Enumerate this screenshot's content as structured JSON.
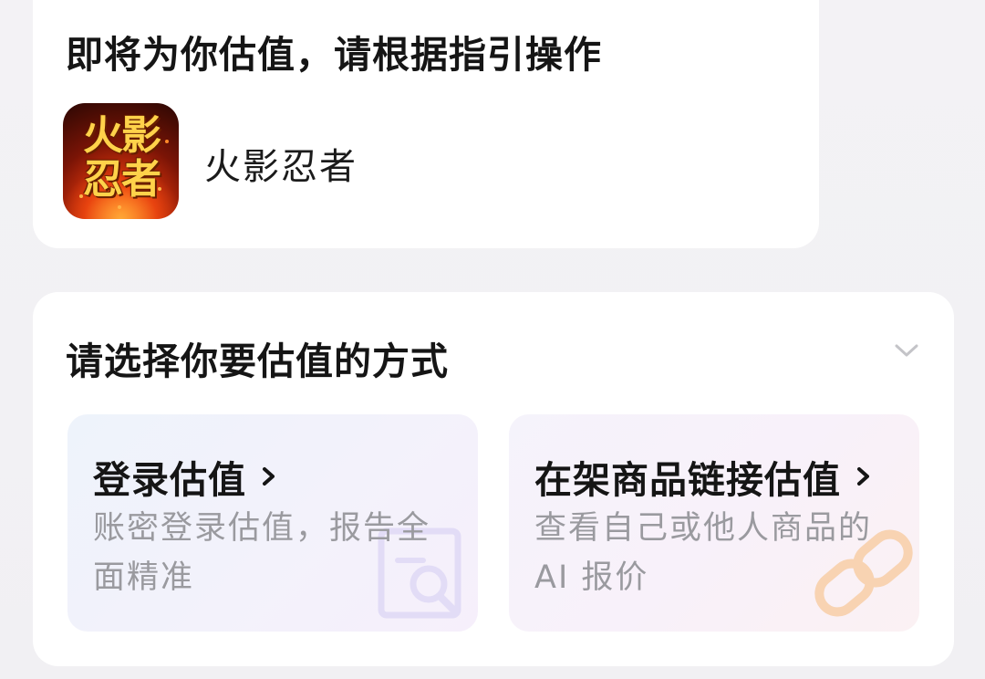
{
  "header": {
    "title": "即将为你估值，请根据指引操作",
    "app": {
      "icon_text_line1": "火影",
      "icon_text_line2": "忍者",
      "name": "火影忍者"
    }
  },
  "valuation": {
    "title": "请选择你要估值的方式",
    "collapse_icon": "chevron-down-icon",
    "options": [
      {
        "title": "登录估值",
        "description": "账密登录估值，报告全面精准",
        "icon": "search-document-icon",
        "chevron_icon": "chevron-right-icon"
      },
      {
        "title": "在架商品链接估值",
        "description": "查看自己或他人商品的 AI 报价",
        "icon": "link-icon",
        "chevron_icon": "chevron-right-icon"
      }
    ]
  },
  "colors": {
    "background": "#f2f1f4",
    "card": "#ffffff",
    "title_text": "#151515",
    "secondary_text": "#9a9a9f",
    "accent_orange": "#f7c79e",
    "accent_purple": "#dcd4f3"
  }
}
